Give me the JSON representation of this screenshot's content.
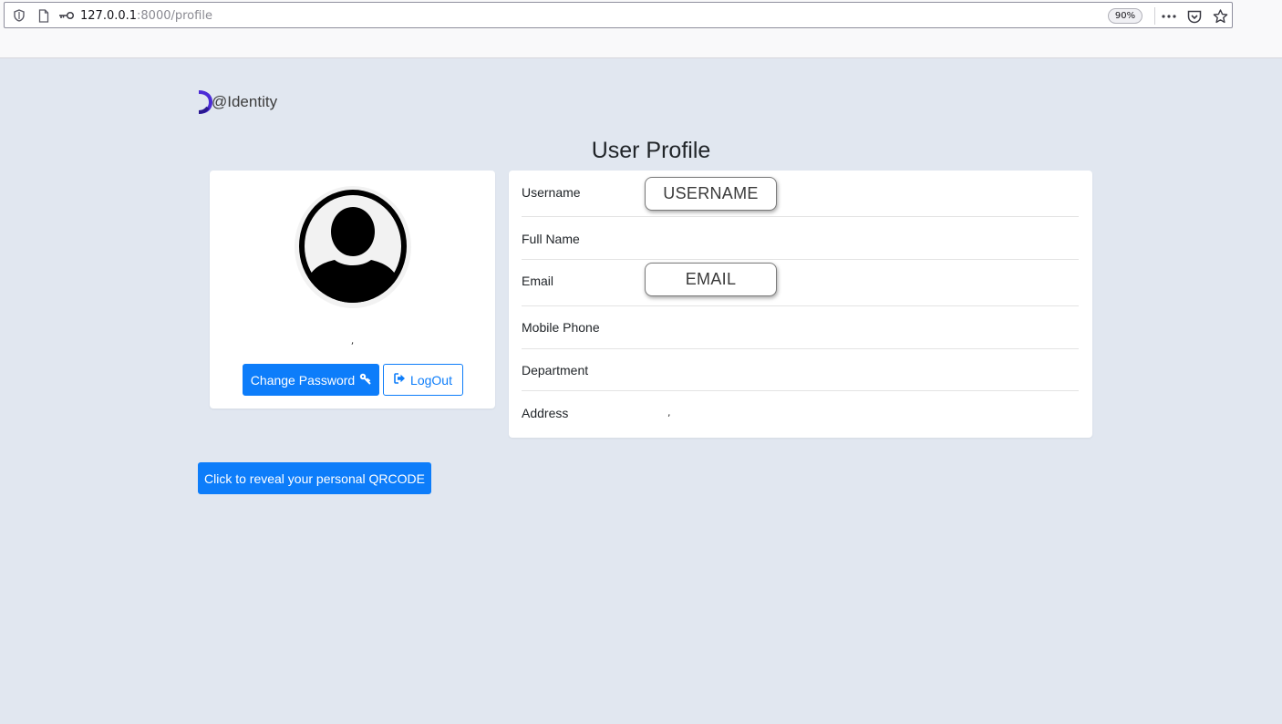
{
  "browser": {
    "url_host": "127.0.0.1",
    "url_rest": ":8000/profile",
    "zoom": "90%"
  },
  "logo": {
    "text": "@Identity"
  },
  "page": {
    "title": "User Profile"
  },
  "profile_card": {
    "name_line": ",",
    "change_password_label": "Change Password",
    "logout_label": "LogOut"
  },
  "details": {
    "rows": [
      {
        "label": "Username",
        "value": ""
      },
      {
        "label": "Full Name",
        "value": ""
      },
      {
        "label": "Email",
        "value": ""
      },
      {
        "label": "Mobile Phone",
        "value": ""
      },
      {
        "label": "Department",
        "value": ""
      },
      {
        "label": "Address",
        "value": ","
      }
    ],
    "username_overlay": "USERNAME",
    "email_overlay": "EMAIL"
  },
  "qr_button": {
    "label": "Click to reveal your personal QRCODE"
  },
  "colors": {
    "primary": "#0d7dfa",
    "background": "#e1e7f0",
    "logo_accent": "#4b2bd6"
  }
}
